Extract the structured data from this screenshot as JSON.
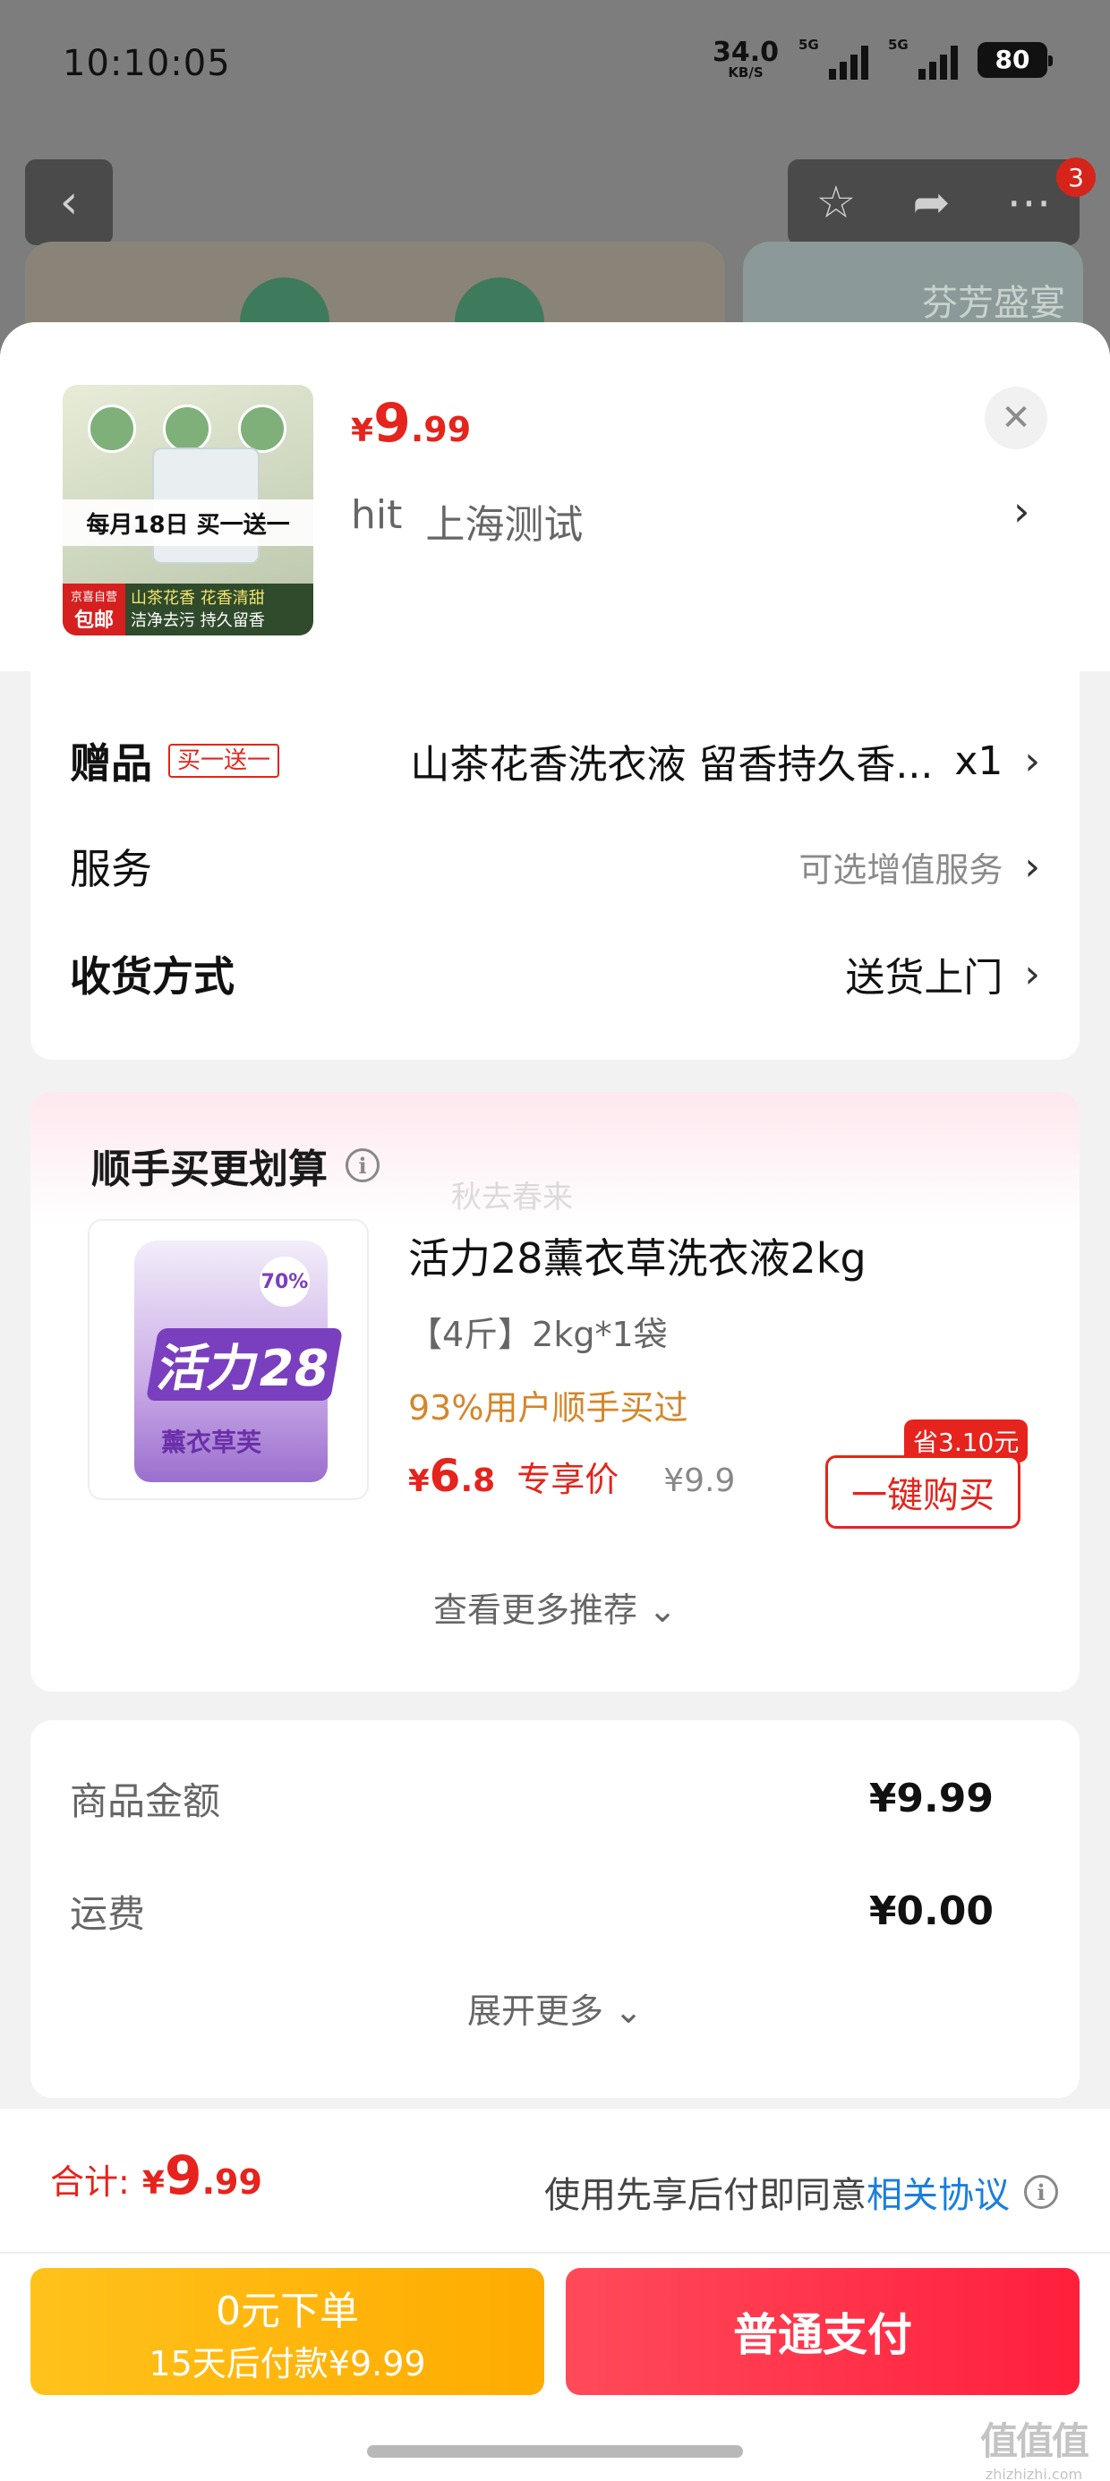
{
  "status_bar": {
    "time": "10:10:05",
    "net_speed": "34.0",
    "net_unit": "KB/S",
    "signal1": "5G",
    "signal2": "5G",
    "battery": "80"
  },
  "background_page": {
    "notification_count": "3",
    "banner_text": "芬芳盛宴",
    "icons": [
      "back-icon",
      "star-icon",
      "share-icon",
      "more-icon"
    ]
  },
  "product": {
    "price_currency": "¥",
    "price_int": "9",
    "price_dec": ".99",
    "address_name": "hit",
    "address_city": "上海测试",
    "thumb": {
      "banner": "每月18日 买一送一",
      "tag_top": "京喜自营",
      "tag_bottom": "包邮",
      "slogan1": "山茶花香 花香清甜",
      "slogan2": "洁净去污 持久留香"
    }
  },
  "options": {
    "gift_label": "赠品",
    "gift_tag": "买一送一",
    "gift_value": "山茶花香洗衣液 留香持久香...",
    "gift_qty": "x1",
    "service_label": "服务",
    "service_value": "可选增值服务",
    "delivery_label": "收货方式",
    "delivery_value": "送货上门"
  },
  "recommend": {
    "title": "顺手买更划算",
    "watermark": "秋去春来",
    "product_name": "活力28薰衣草洗衣液2kg",
    "spec": "【4斤】2kg*1袋",
    "hint": "93%用户顺手买过",
    "price_currency": "¥",
    "price_int": "6",
    "price_dec": ".8",
    "exclusive_label": "专享价",
    "old_price": "¥9.9",
    "save_tag": "省3.10元",
    "buy_button": "一键购买",
    "more_label": "查看更多推荐",
    "image": {
      "logo": "活力28",
      "pct": "70%",
      "sub": "薰衣草芙"
    }
  },
  "summary": {
    "goods_label": "商品金额",
    "goods_value": "¥9.99",
    "shipping_label": "运费",
    "shipping_value": "¥0.00",
    "expand_label": "展开更多"
  },
  "footer": {
    "total_label": "合计:",
    "total_currency": "¥",
    "total_int": "9",
    "total_dec": ".99",
    "agree_text": "使用先享后付即同意",
    "agree_link": "相关协议",
    "pay_later_line1": "0元下单",
    "pay_later_line2": "15天后付款¥9.99",
    "pay_normal": "普通支付"
  },
  "site_mark": {
    "glyphs": "值值值",
    "domain": "zhizhizhi.com"
  },
  "colors": {
    "accent_red": "#e6231c",
    "link_blue": "#1a7ee0",
    "pay_later": "#ffb300",
    "hint_orange": "#d5862a"
  }
}
